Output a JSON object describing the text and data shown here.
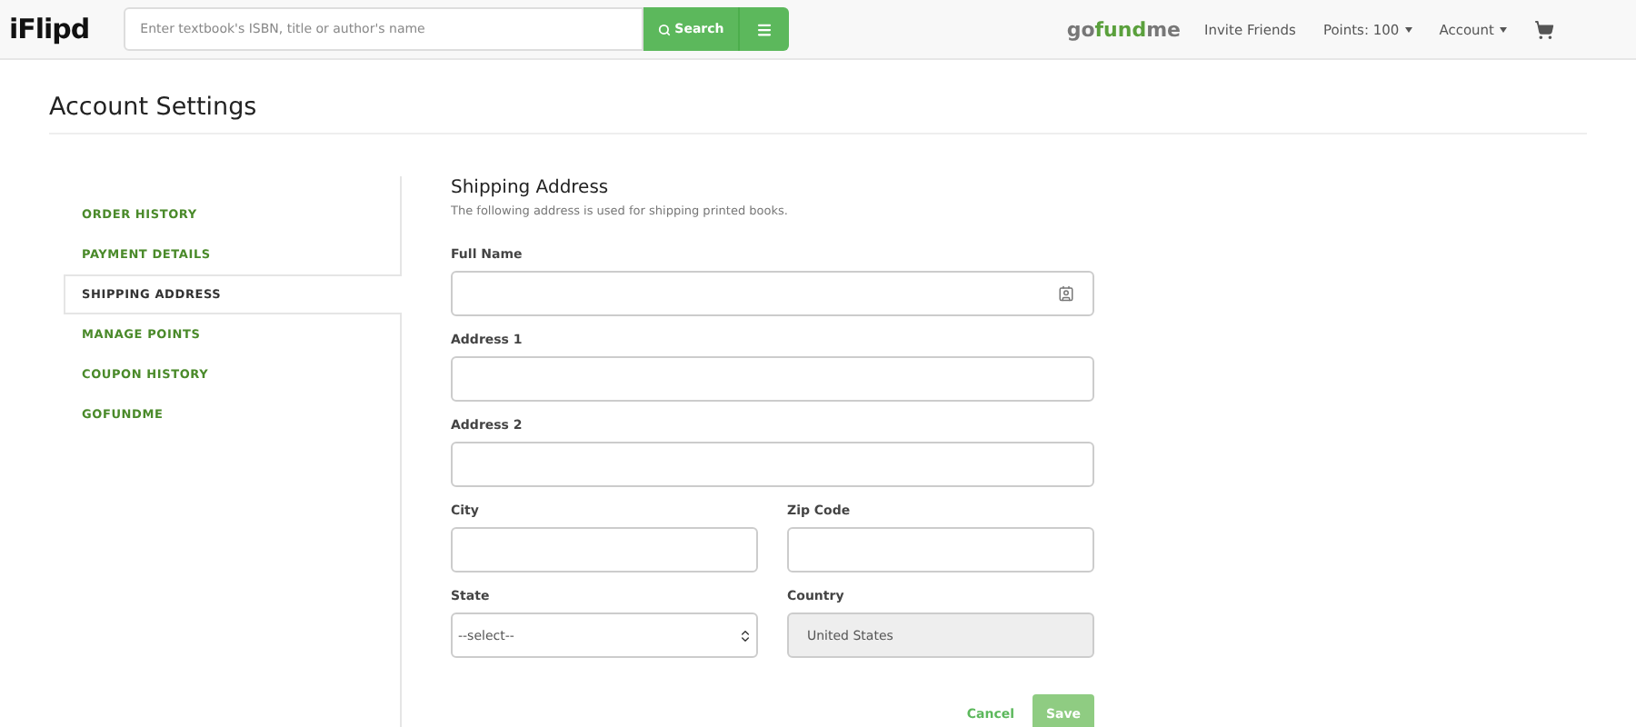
{
  "header": {
    "logo": "iFlipd",
    "search": {
      "placeholder": "Enter textbook's ISBN, title or author's name",
      "button": "Search"
    },
    "partner": {
      "parts": [
        "go",
        "fund",
        "me"
      ]
    },
    "links": [
      {
        "label": "Invite Friends",
        "dropdown": false
      },
      {
        "label": "Points: 100",
        "dropdown": true
      },
      {
        "label": "Account",
        "dropdown": true
      }
    ]
  },
  "page": {
    "title": "Account Settings"
  },
  "sidebar": {
    "items": [
      {
        "label": "ORDER HISTORY",
        "selected": false
      },
      {
        "label": "PAYMENT DETAILS",
        "selected": false
      },
      {
        "label": "SHIPPING ADDRESS",
        "selected": true
      },
      {
        "label": "MANAGE POINTS",
        "selected": false
      },
      {
        "label": "COUPON HISTORY",
        "selected": false
      },
      {
        "label": "GOFUNDME",
        "selected": false
      }
    ]
  },
  "form": {
    "title": "Shipping Address",
    "subtitle": "The following address is used for shipping printed books.",
    "rows": [
      [
        {
          "label": "Full Name",
          "kind": "text",
          "contact_icon": true
        }
      ],
      [
        {
          "label": "Address 1",
          "kind": "text"
        }
      ],
      [
        {
          "label": "Address 2",
          "kind": "text"
        }
      ],
      [
        {
          "label": "City",
          "kind": "text"
        },
        {
          "label": "Zip Code",
          "kind": "text"
        }
      ],
      [
        {
          "label": "State",
          "kind": "select",
          "value": "--select--"
        },
        {
          "label": "Country",
          "kind": "disabled",
          "value": "United States"
        }
      ]
    ],
    "buttons": {
      "cancel": "Cancel",
      "save": "Save"
    }
  }
}
